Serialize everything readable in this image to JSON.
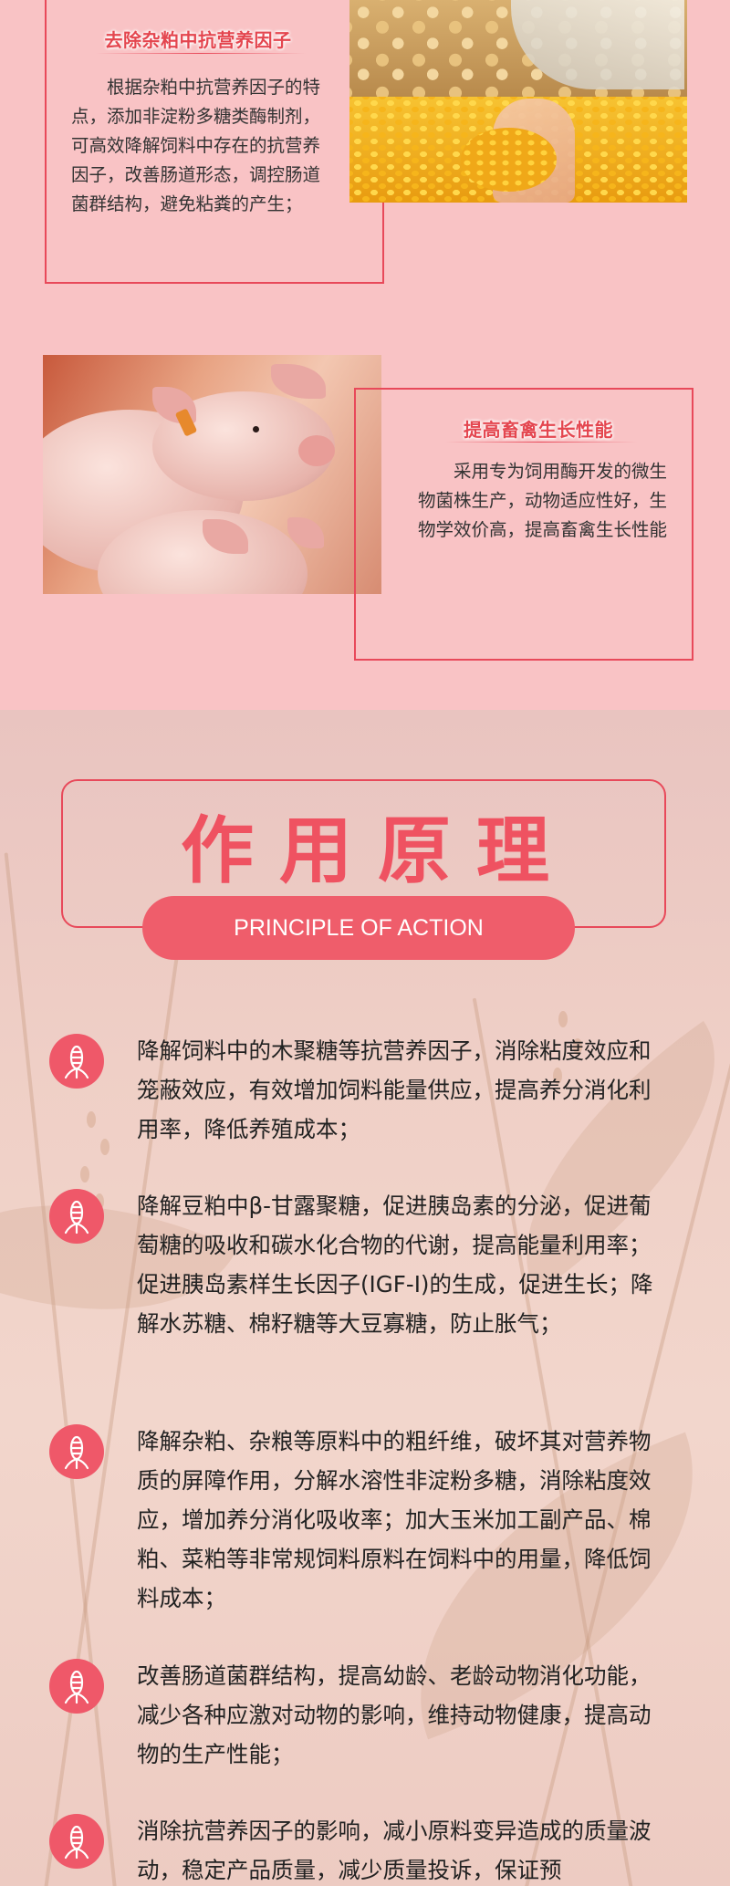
{
  "features": [
    {
      "title": "去除杂粕中抗营养因子",
      "body": "根据杂粕中抗营养因子的特点，添加非淀粉多糖类酶制剂，可高效降解饲料中存在的抗营养因子，改善肠道形态，调控肠道菌群结构，避免粘粪的产生；"
    },
    {
      "title": "提高畜禽生长性能",
      "body": "采用专为饲用酶开发的微生物菌株生产，动物适应性好，生物学效价高，提高畜禽生长性能"
    }
  ],
  "principle_section": {
    "heading_cn": "作用原理",
    "heading_en": "PRINCIPLE OF ACTION",
    "items": [
      "降解饲料中的木聚糖等抗营养因子，消除粘度效应和笼蔽效应，有效增加饲料能量供应，提高养分消化利用率，降低养殖成本；",
      "降解豆粕中β-甘露聚糖，促进胰岛素的分泌，促进葡萄糖的吸收和碳水化合物的代谢，提高能量利用率；促进胰岛素样生长因子(IGF-I)的生成，促进生长；降解水苏糖、棉籽糖等大豆寡糖，防止胀气；",
      "降解杂粕、杂粮等原料中的粗纤维，破坏其对营养物质的屏障作用，分解水溶性非淀粉多糖，消除粘度效应，增加养分消化吸收率；加大玉米加工副产品、棉粕、菜粕等非常规饲料原料在饲料中的用量，降低饲料成本；",
      "改善肠道菌群结构，提高幼龄、老龄动物消化功能，减少各种应激对动物的影响，维持动物健康，提高动物的生产性能；",
      "消除抗营养因子的影响，减小原料变异造成的质量波动，稳定产品质量，减少质量投诉，保证预"
    ],
    "icon": "corn-icon"
  },
  "colors": {
    "accent": "#e8495a",
    "pill": "#ef5d6b",
    "background_top": "#f9c3c5"
  }
}
